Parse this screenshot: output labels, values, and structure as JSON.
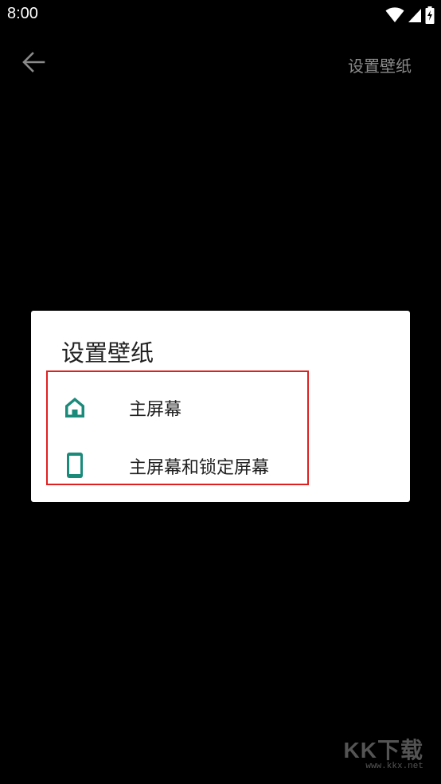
{
  "status_bar": {
    "time": "8:00",
    "icons": [
      "wifi-icon",
      "signal-icon",
      "battery-charging-icon"
    ]
  },
  "app_bar": {
    "back_icon": "arrow-back-icon",
    "action_label": "设置壁纸"
  },
  "dialog": {
    "title": "设置壁纸",
    "options": [
      {
        "icon": "home-icon",
        "label": "主屏幕"
      },
      {
        "icon": "phone-icon",
        "label": "主屏幕和锁定屏幕"
      }
    ],
    "accent_color": "#1a8a7a",
    "highlight_color": "#e02020"
  },
  "watermark": {
    "logo": "KK下载",
    "url": "www.kkx.net"
  }
}
